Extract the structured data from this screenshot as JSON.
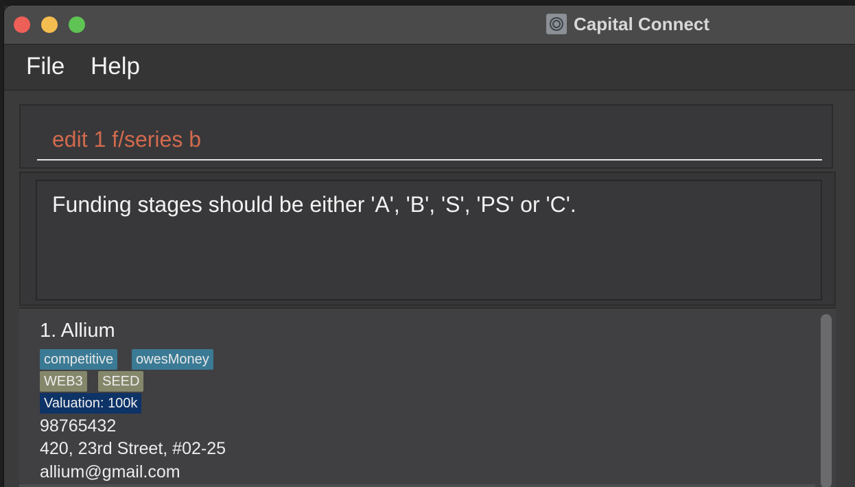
{
  "window": {
    "title": "Capital Connect"
  },
  "menu": {
    "file": "File",
    "help": "Help"
  },
  "command": {
    "value": "edit 1 f/series b"
  },
  "result": {
    "message": "Funding stages should be either 'A', 'B', 'S', 'PS' or 'C'."
  },
  "startups": [
    {
      "index_name": "1.  Allium",
      "tags": [
        "competitive",
        "owesMoney"
      ],
      "industry": "WEB3",
      "funding_stage": "SEED",
      "valuation": "Valuation: 100k",
      "phone": "98765432",
      "address": "420, 23rd Street, #02-25",
      "email": "allium@gmail.com"
    }
  ],
  "colors": {
    "tag": "#3a7a95",
    "category": "#85876b",
    "valuation": "#0d3367",
    "command_text": "#d26a4e"
  }
}
